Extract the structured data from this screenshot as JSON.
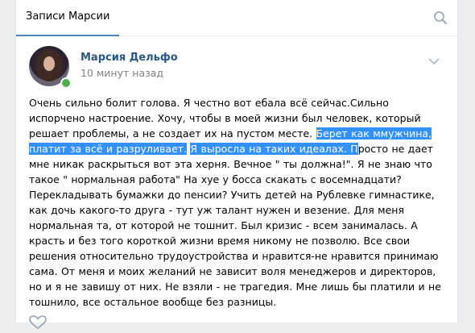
{
  "tabs": {
    "active_label": "Записи Марсии"
  },
  "post": {
    "author": "Марсия Дельфо",
    "time": "10 минут назад",
    "text_before": "Очень сильно болит голова. Я честно вот ебала всё сейчас.Сильно испорчено настроение. Хочу, чтобы в моей жизни был человек, который решает проблемы, а не создает их на пустом месте.",
    "text_highlight_1": "Берет как ммужчина, платит за всё и разруливает.",
    "text_highlight_2": "Я выросла на таких идеалах. П",
    "text_after": "росто не дает мне никак раскрыться вот эта херня. Вечное \" ты должна!\". Я не знаю что такое \" нормальная работа\" На хуе у босса скакать с восемнадцати? Перекладывать бумажки до пенсии? Учить детей на Рублевке гимнастике, как дочь какого-то друга - тут уж талант нужен и везение. Для меня нормальная та, от которой не тошнит. Был кризис - всем занималась. А красть и без того короткой жизни время никому не позволю. Все свои решения относительно трудоустройства и нравится-не нравится принимаю сама. От меня и моих желаний не зависит воля менеджеров и директоров, но и я не завишу от них. Не взяли - не трагедия. Мне лишь бы платили и не тошнило, все остальное вообще без разницы."
  },
  "colors": {
    "link": "#2a5885",
    "tab_underline": "#5181b8",
    "highlight": "#3390ff",
    "online": "#4bb34b"
  },
  "icons": {
    "search": "search-icon",
    "menu": "chevron-down-icon",
    "like": "heart-icon"
  }
}
